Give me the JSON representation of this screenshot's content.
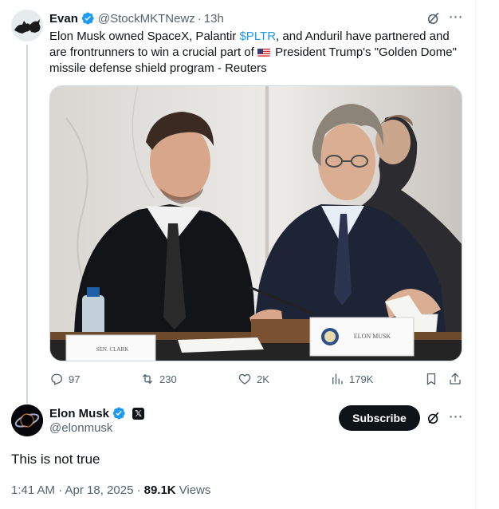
{
  "colors": {
    "text_primary": "#0f1419",
    "text_secondary": "#536471",
    "link": "#1d9bf0",
    "verified": "#1d9bf0",
    "button_dark": "#0f1419"
  },
  "tweet": {
    "author_name": "Evan",
    "author_handle": "@StockMKTNewz",
    "separator": "·",
    "time": "13h",
    "text_before_cashtag": "Elon Musk owned SpaceX, Palantir ",
    "cashtag": "$PLTR",
    "text_after_cashtag": ", and Anduril have partnered and are frontrunners to win a crucial part of ",
    "text_after_flag": "President Trump's \"Golden Dome\" missile defense shield program - Reuters",
    "flag_icon": "us-flag-icon",
    "image_placard_left": "SEN. CLARK",
    "image_placard_right": "ELON MUSK",
    "actions": {
      "replies": "97",
      "reposts": "230",
      "likes": "2K",
      "views": "179K"
    }
  },
  "reply": {
    "author_name": "Elon Musk",
    "author_handle": "@elonmusk",
    "affiliation_badge": "𝕏",
    "subscribe_label": "Subscribe",
    "text": "This is not true",
    "timestamp": "1:41 AM · Apr 18, 2025 ·",
    "views_count": "89.1K",
    "views_label": "Views"
  }
}
